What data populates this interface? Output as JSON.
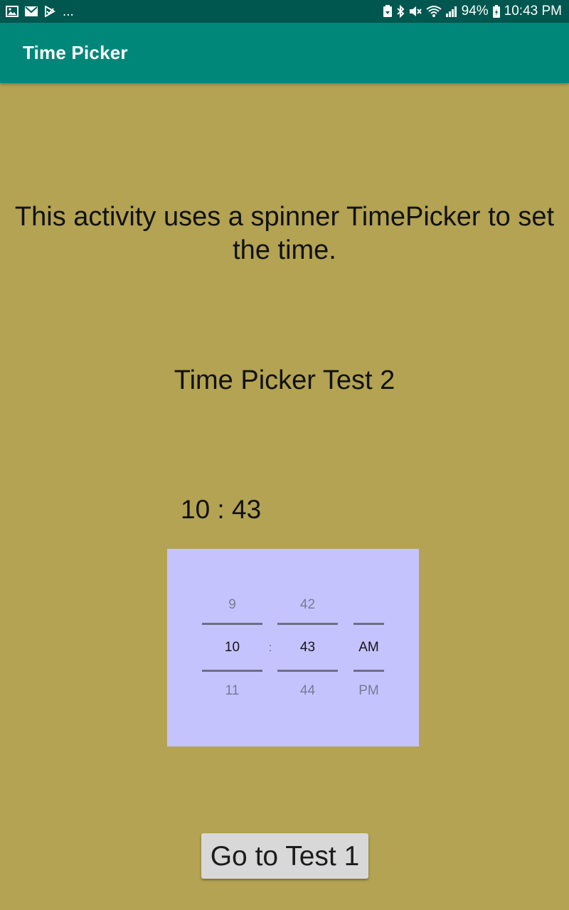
{
  "status_bar": {
    "left_icons": [
      "image-icon",
      "mail-icon",
      "check-icon"
    ],
    "overflow": "...",
    "right_icons": [
      "battery-saver-icon",
      "bluetooth-icon",
      "mute-icon",
      "wifi-icon",
      "signal-icon"
    ],
    "battery_percent": "94%",
    "time": "10:43 PM"
  },
  "app_bar": {
    "title": "Time Picker"
  },
  "content": {
    "description": "This activity uses a spinner TimePicker to set the time.",
    "test_title": "Time Picker Test 2",
    "time_display": "10 : 43"
  },
  "picker": {
    "hour": {
      "prev": "9",
      "current": "10",
      "next": "11"
    },
    "separator": ":",
    "minute": {
      "prev": "42",
      "current": "43",
      "next": "44"
    },
    "ampm": {
      "current": "AM",
      "next": "PM"
    }
  },
  "button": {
    "label": "Go to Test 1"
  },
  "colors": {
    "status_bar": "#00574f",
    "app_bar": "#00877a",
    "background": "#b3a352",
    "picker_background": "#c5c3fd",
    "button": "#d8d8d8"
  }
}
